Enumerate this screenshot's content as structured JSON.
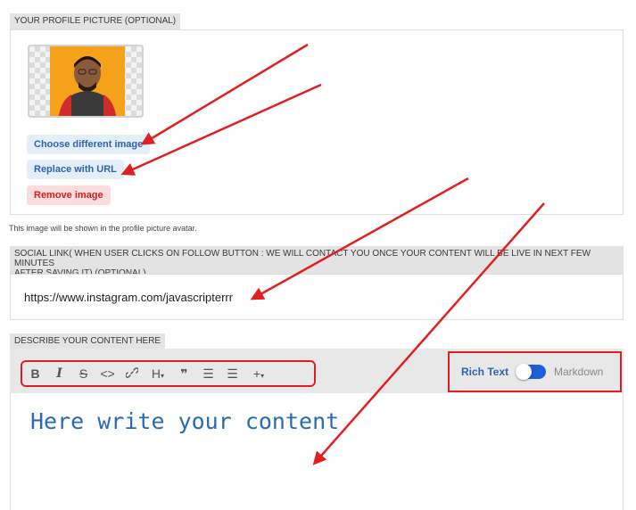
{
  "profile_picture": {
    "section_label": "YOUR PROFILE PICTURE (OPTIONAL)",
    "choose_button": "Choose different image",
    "replace_button": "Replace with URL",
    "remove_button": "Remove image",
    "hint": "This image will be shown in the profile picture avatar."
  },
  "social_link": {
    "section_label_line1": "SOCIAL LINK( WHEN USER CLICKS ON FOLLOW BUTTON : WE WILL CONTACT YOU ONCE YOUR CONTENT WILL BE LIVE IN NEXT FEW MINUTES",
    "section_label_line2": "AFTER SAVING IT) (OPTIONAL)",
    "value": "https://www.instagram.com/javascripterrr"
  },
  "content": {
    "section_label": "DESCRIBE YOUR CONTENT HERE",
    "toolbar": {
      "bold": "B",
      "italic": "I",
      "strike": "S",
      "code": "<>",
      "link": "🔗",
      "heading": "H",
      "quote": "❞",
      "bullets": "☰",
      "numbers": "☰",
      "more": "+"
    },
    "mode_rich": "Rich Text",
    "mode_markdown": "Markdown",
    "placeholder": "Here write your content"
  },
  "colors": {
    "accent": "#2d63b0",
    "toggle": "#1e5ed6",
    "annotation": "#e02020"
  }
}
